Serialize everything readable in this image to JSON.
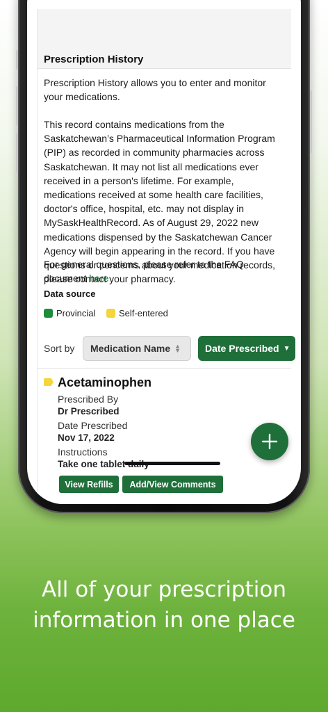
{
  "section": {
    "title": "Prescription History"
  },
  "intro": "Prescription History allows you to enter and monitor your medications.",
  "record_text": "This record contains medications from the Saskatchewan’s Pharmaceutical Information Program (PIP) as recorded in community pharmacies across Saskatchewan. It may not list all medications ever received in a person's lifetime. For example, medications received at some health care facilities, doctor's office, hospital, etc. may not display in MySaskHealthRecord. As of August 29, 2022 new medications dispensed by the Saskatchewan Cancer Agency will begin appearing in the record. If you have questions or concerns about your medication records, please contact your pharmacy.",
  "faq": {
    "text": "For general questions, please refer to the FAQ document ",
    "link": "here"
  },
  "data_source": {
    "title": "Data source",
    "provincial": {
      "label": "Provincial",
      "color": "#1e8c3a"
    },
    "self_entered": {
      "label": "Self-entered",
      "color": "#f4d53b"
    }
  },
  "sort": {
    "label": "Sort by",
    "options": [
      "Medication Name",
      "Date Prescribed"
    ],
    "selected": "Date Prescribed"
  },
  "medication": {
    "name": "Acetaminophen",
    "source": "self-entered",
    "prescribed_by_label": "Prescribed By",
    "prescribed_by": "Dr Prescribed",
    "date_label": "Date Prescribed",
    "date": "Nov 17, 2022",
    "instructions_label": "Instructions",
    "instructions": "Take one tablet daily",
    "buttons": {
      "refills": "View Refills",
      "comments": "Add/View Comments"
    }
  },
  "fab": {
    "icon": "plus-icon"
  },
  "caption": {
    "line1": "All of your prescription",
    "line2": "information in one place"
  },
  "colors": {
    "primary": "#1f6f3a",
    "background_green": "#6db23c"
  }
}
